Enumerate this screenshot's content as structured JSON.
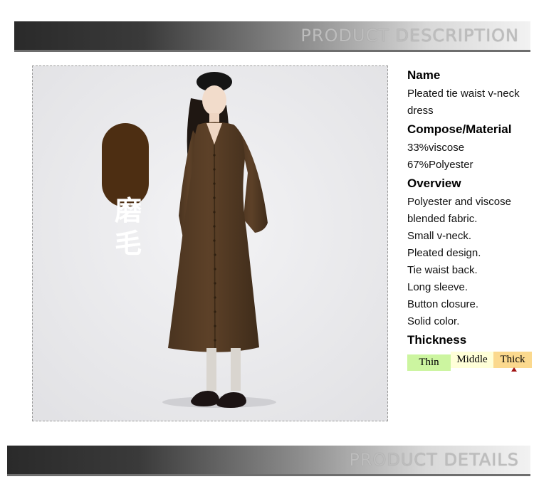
{
  "header": {
    "title": "PRODUCT DESCRIPTION"
  },
  "footer": {
    "title": "PRODUCT DETAILS"
  },
  "photo": {
    "badge_text_1": "磨",
    "badge_text_2": "毛"
  },
  "details": {
    "name_heading": "Name",
    "name_value_1": "Pleated tie waist v-neck",
    "name_value_2": "dress",
    "material_heading": "Compose/Material",
    "material_1": "33%viscose",
    "material_2": "67%Polyester",
    "overview_heading": "Overview",
    "overview": [
      "Polyester and viscose",
      "blended fabric.",
      "Small v-neck.",
      "Pleated design.",
      "Tie waist back.",
      "Long sleeve.",
      "Button closure.",
      "Solid color."
    ],
    "thickness_heading": "Thickness",
    "thickness_levels": [
      "Thin",
      "Middle",
      "Thick"
    ],
    "thickness_selected": "Thick"
  },
  "colors": {
    "dress": "#5b4024",
    "scale_thin": "#ccf5a0",
    "scale_middle": "#ffffd8",
    "scale_thick": "#fbd98e",
    "marker": "#a01212"
  }
}
